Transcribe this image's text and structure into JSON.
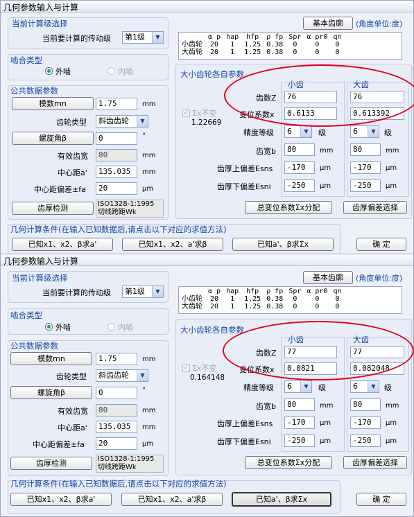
{
  "windows": [
    {
      "title": "几何参数输入与计算",
      "stage_group_title": "当前计算级选择",
      "stage_label": "当前要计算的传动级",
      "stage_value": "第1级",
      "basic_profile_button": "基本齿廓",
      "angle_unit_note": "(角度单位:度)",
      "params_table": {
        "headers": [
          "α p",
          "hap",
          "hfp",
          "ρ fp",
          "Spr",
          "α pr0",
          "qn"
        ],
        "rows": [
          {
            "name": "小齿轮",
            "values": [
              "20",
              "1",
              "1.25",
              "0.38",
              "0",
              "0",
              "0"
            ]
          },
          {
            "name": "大齿轮",
            "values": [
              "20",
              "1",
              "1.25",
              "0.38",
              "0",
              "0",
              "0"
            ]
          }
        ]
      },
      "mesh_group_title": "啮合类型",
      "mesh_external": "外啮",
      "mesh_internal": "内啮",
      "common_group_title": "公共数据参数",
      "module_button": "模数mn",
      "module_value": "1.75",
      "module_unit": "mm",
      "gear_type_label": "齿轮类型",
      "gear_type_value": "斜齿齿轮",
      "helix_button": "螺旋角β",
      "helix_value": "0",
      "helix_unit": "°",
      "effective_width_label": "有效齿宽",
      "effective_width_value": "80",
      "effective_width_unit": "mm",
      "center_distance_label": "中心距a'",
      "center_distance_value": "135.035",
      "center_distance_unit": "mm",
      "center_dev_label": "中心距偏差±fa",
      "center_dev_value": "20",
      "center_dev_unit": "μm",
      "thickness_check_button": "齿厚检测",
      "thickness_standard_line1": "ISO1328-1:1995",
      "thickness_standard_line2": "切线跨距Wk",
      "gears_group_title": "大小齿轮各自参数",
      "small_gear_title": "小齿",
      "large_gear_title": "大齿",
      "sigma_fixed_label": "Σx不变",
      "sigma_value": "1.22669",
      "teeth_label": "齿数Z",
      "small_teeth": "76",
      "large_teeth": "76",
      "shift_label": "变位系数x",
      "small_shift": "0.6133",
      "large_shift": "0.613392",
      "grade_label": "精度等级",
      "small_grade": "6",
      "large_grade": "6",
      "grade_unit": "级",
      "width_label": "齿宽b",
      "small_width": "80",
      "large_width": "80",
      "width_unit": "mm",
      "upper_dev_label": "齿厚上偏差Esns",
      "small_upper_dev": "-170",
      "large_upper_dev": "-170",
      "lower_dev_label": "齿厚下偏差Esni",
      "small_lower_dev": "-250",
      "large_lower_dev": "-250",
      "dev_unit": "μm",
      "total_shift_button": "总变位系数Σx分配",
      "thickness_dev_button": "齿厚偏差选择",
      "calc_group_title": "几何计算条件(在输入已知数据后,请点击以下对应的求值方法)",
      "calc_button_1": "已知x1、x2、β求a'",
      "calc_button_2": "已知x1、x2、a'求β",
      "calc_button_3": "已知a'、β求Σx",
      "ok_button": "确  定"
    },
    {
      "title": "几何参数输入与计算",
      "stage_group_title": "当前计算级选择",
      "stage_label": "当前要计算的传动级",
      "stage_value": "第1级",
      "basic_profile_button": "基本齿廓",
      "angle_unit_note": "(角度单位:度)",
      "params_table": {
        "headers": [
          "α p",
          "hap",
          "hfp",
          "ρ fp",
          "Spr",
          "α pr0",
          "qn"
        ],
        "rows": [
          {
            "name": "小齿轮",
            "values": [
              "20",
              "1",
              "1.25",
              "0.38",
              "0",
              "0",
              "0"
            ]
          },
          {
            "name": "大齿轮",
            "values": [
              "20",
              "1",
              "1.25",
              "0.38",
              "0",
              "0",
              "0"
            ]
          }
        ]
      },
      "mesh_group_title": "啮合类型",
      "mesh_external": "外啮",
      "mesh_internal": "内啮",
      "common_group_title": "公共数据参数",
      "module_button": "模数mn",
      "module_value": "1.75",
      "module_unit": "mm",
      "gear_type_label": "齿轮类型",
      "gear_type_value": "斜齿齿轮",
      "helix_button": "螺旋角β",
      "helix_value": "0",
      "helix_unit": "°",
      "effective_width_label": "有效齿宽",
      "effective_width_value": "80",
      "effective_width_unit": "mm",
      "center_distance_label": "中心距a'",
      "center_distance_value": "135.035",
      "center_distance_unit": "mm",
      "center_dev_label": "中心距偏差±fa",
      "center_dev_value": "20",
      "center_dev_unit": "μm",
      "thickness_check_button": "齿厚检测",
      "thickness_standard_line1": "ISO1328-1:1995",
      "thickness_standard_line2": "切线跨距Wk",
      "gears_group_title": "大小齿轮各自参数",
      "small_gear_title": "小齿",
      "large_gear_title": "大齿",
      "sigma_fixed_label": "Σx不变",
      "sigma_value": "0.164148",
      "teeth_label": "齿数Z",
      "small_teeth": "77",
      "large_teeth": "77",
      "shift_label": "变位系数x",
      "small_shift": "0.0821",
      "large_shift": "0.082048",
      "grade_label": "精度等级",
      "small_grade": "6",
      "large_grade": "6",
      "grade_unit": "级",
      "width_label": "齿宽b",
      "small_width": "80",
      "large_width": "80",
      "width_unit": "mm",
      "upper_dev_label": "齿厚上偏差Esns",
      "small_upper_dev": "-170",
      "large_upper_dev": "-170",
      "lower_dev_label": "齿厚下偏差Esni",
      "small_lower_dev": "-250",
      "large_lower_dev": "-250",
      "dev_unit": "μm",
      "total_shift_button": "总变位系数Σx分配",
      "thickness_dev_button": "齿厚偏差选择",
      "calc_group_title": "几何计算条件(在输入已知数据后,请点击以下对应的求值方法)",
      "calc_button_1": "已知x1、x2、β求a'",
      "calc_button_2": "已知x1、x2、a'求β",
      "calc_button_3": "已知a'、β求Σx",
      "ok_button": "确  定"
    }
  ],
  "colors": {
    "group_title": "#1447a6",
    "highlight_ellipse": "#e0001b",
    "radio_selected": "#1fa233"
  }
}
